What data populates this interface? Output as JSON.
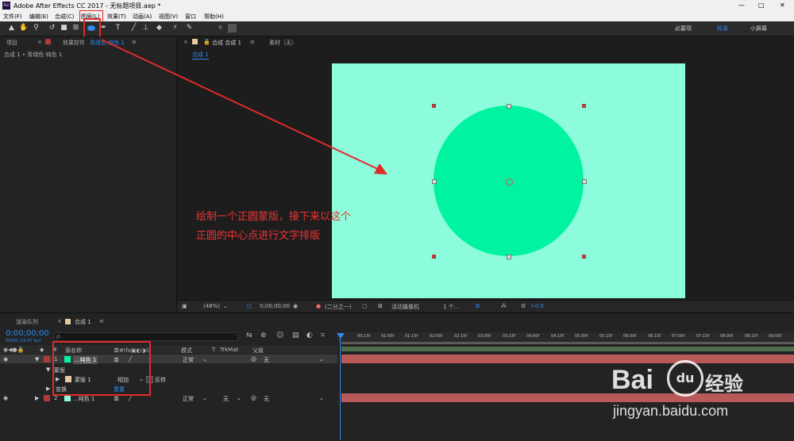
{
  "app": {
    "title": "Adobe After Effects CC 2017 - 无标题项目.aep *",
    "logo": "Ae",
    "window_buttons": [
      "—",
      "□",
      "✕"
    ]
  },
  "menu": [
    "文件(F)",
    "编辑(E)",
    "合成(C)",
    "图层(L)",
    "效果(T)",
    "动画(A)",
    "视图(V)",
    "窗口",
    "帮助(H)"
  ],
  "toolbar": {
    "icons": [
      "selection-tool-icon",
      "hand-tool-icon",
      "zoom-tool-icon",
      "rotate-tool-icon",
      "camera-tool-icon",
      "pan-behind-tool-icon",
      "ellipse-tool-icon",
      "pen-tool-icon",
      "text-tool-icon",
      "brush-tool-icon",
      "clone-stamp-tool-icon",
      "eraser-tool-icon",
      "roto-brush-tool-icon",
      "puppet-pin-tool-icon"
    ],
    "text_tool": "T",
    "workspaces": [
      "必要项",
      "标准",
      "小屏幕"
    ],
    "accent": "#2d8cf0"
  },
  "left_panel": {
    "tabs": [
      "项目",
      "效果控件",
      "青绿色 纯色 1"
    ],
    "breadcrumb": "合成 1 • 青绿色 纯色 1"
  },
  "comp_panel": {
    "tab": "合成 合成 1",
    "footage_tab": "素材（无）",
    "subtab": "合成 1",
    "canvas_color": "#8dfcdc",
    "circle_color": "#00f3a0"
  },
  "annotation": {
    "line1": "绘制一个正圆蒙版，接下来以这个",
    "line2": "正圆的中心点进行文字排版",
    "color": "#e33333"
  },
  "viewer_bar": {
    "zoom": "(48%)",
    "timecode": "0;00;00;00",
    "resolution": "(二分之一)",
    "camera": "活动摄像机",
    "views": "1 个...",
    "exposure": "+0.0"
  },
  "timeline": {
    "tabs": [
      "渲染队列",
      "合成 1"
    ],
    "timecode": "0;00;00;00",
    "fps": "00000 (29.97 fps)",
    "search_placeholder": "ρ.",
    "ticks": [
      "00:15f",
      "01:00f",
      "01:15f",
      "02:00f",
      "02:15f",
      "03:00f",
      "03:15f",
      "04:00f",
      "04:15f",
      "05:00f",
      "05:15f",
      "06:00f",
      "06:15f",
      "07:00f",
      "07:15f",
      "08:00f",
      "08:15f",
      "09:00f"
    ],
    "columns": {
      "source": "源名称",
      "mode": "模式",
      "t": "T",
      "trkmat": "TrkMat",
      "parent": "父级"
    },
    "layers": [
      {
        "num": "1",
        "name": "...纯色 1",
        "mode": "正常",
        "trkmat": "",
        "parent": "无",
        "color": "#00f3a0"
      },
      {
        "num": "2",
        "name": "...纯色 1",
        "mode": "正常",
        "trkmat": "无",
        "parent": "无",
        "color": "#8dfcdc"
      }
    ],
    "mask_group": "蒙版",
    "mask_name": "蒙版 1",
    "mask_mode": "相加",
    "mask_invert": "反转",
    "transform": "变换",
    "transform_reset": "重置"
  },
  "watermark": {
    "brand": "Bai",
    "paw": "du",
    "jingyan": "经验",
    "url": "jingyan.baidu.com"
  }
}
